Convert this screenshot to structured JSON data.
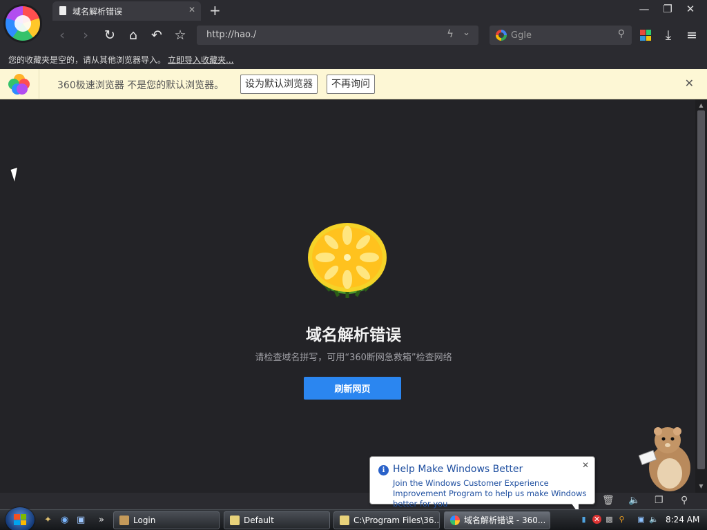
{
  "browser": {
    "tab_title": "域名解析错误",
    "url": "http://hao./",
    "search_placeholder": "Ggle"
  },
  "bookmark_bar": {
    "message": "您的收藏夹是空的，请从其他浏览器导入。",
    "import_link": "立即导入收藏夹..."
  },
  "banner": {
    "text": "360极速浏览器 不是您的默认浏览器。",
    "set_default_label": "设为默认浏览器",
    "dont_ask_label": "不再询问"
  },
  "error_page": {
    "title": "域名解析错误",
    "subtitle": "请检查域名拼写，可用“360断网急救箱”检查网络",
    "refresh_label": "刷新网页"
  },
  "balloon": {
    "title": "Help Make Windows Better",
    "body": "Join the Windows Customer Experience Improvement Program to help us make Windows better for you"
  },
  "taskbar": {
    "tasks": [
      {
        "label": "Login"
      },
      {
        "label": "Default"
      },
      {
        "label": "C:\\Program Files\\36..."
      },
      {
        "label": "域名解析错误 - 360..."
      }
    ],
    "clock": "8:24 AM"
  },
  "colors": {
    "accent_blue": "#2b86f0",
    "banner_bg": "#fdf7d5",
    "page_bg": "#232327"
  }
}
